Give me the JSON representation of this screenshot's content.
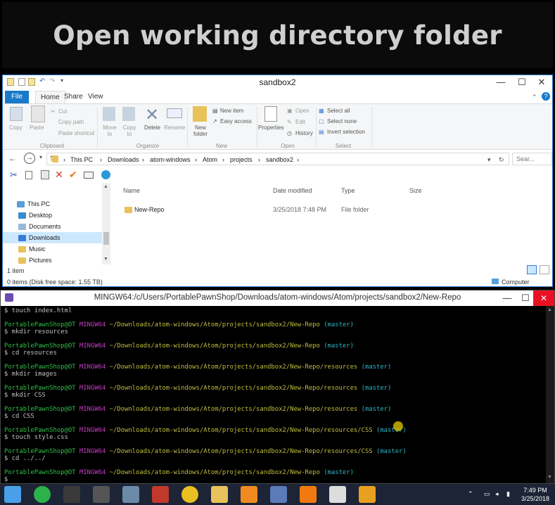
{
  "banner": {
    "title": "Open working directory folder"
  },
  "explorer": {
    "window_title": "sandbox2",
    "tabs": [
      "File",
      "Home",
      "Share",
      "View"
    ],
    "ribbon": {
      "clipboard": {
        "copy": "Copy",
        "paste": "Paste",
        "cut": "Cut",
        "copy_path": "Copy path",
        "paste_shortcut": "Paste shortcut",
        "group": "Clipboard"
      },
      "organize": {
        "move_to": "Move to",
        "copy_to": "Copy to",
        "delete": "Delete",
        "rename": "Rename",
        "group": "Organize"
      },
      "new": {
        "new_folder": "New folder",
        "new_item": "New item",
        "easy_access": "Easy access",
        "group": "New"
      },
      "open": {
        "properties": "Properties",
        "open": "Open",
        "edit": "Edit",
        "history": "History",
        "group": "Open"
      },
      "select": {
        "select_all": "Select all",
        "select_none": "Select none",
        "invert": "Invert selection",
        "group": "Select"
      }
    },
    "breadcrumb": [
      "This PC",
      "Downloads",
      "atom-windows",
      "Atom",
      "projects",
      "sandbox2"
    ],
    "search_placeholder": "Sear...",
    "nav": [
      "This PC",
      "Desktop",
      "Documents",
      "Downloads",
      "Music",
      "Pictures"
    ],
    "columns": {
      "name": "Name",
      "date": "Date modified",
      "type": "Type",
      "size": "Size"
    },
    "files": [
      {
        "name": "New-Repo",
        "date": "3/25/2018 7:48 PM",
        "type": "File folder"
      }
    ],
    "status": {
      "items": "1 item",
      "details": "0 items (Disk free space: 1.55 TB)",
      "computer": "Computer"
    }
  },
  "terminal": {
    "title": "MINGW64:/c/Users/PortablePawnShop/Downloads/atom-windows/Atom/projects/sandbox2/New-Repo",
    "user": "PortablePawnShop@OT",
    "host": "MINGW64",
    "first_cmd": "$ touch index.html",
    "blocks": [
      {
        "path": "~/Downloads/atom-windows/Atom/projects/sandbox2/New-Repo",
        "branch": "(master)",
        "cmd": "$ mkdir resources"
      },
      {
        "path": "~/Downloads/atom-windows/Atom/projects/sandbox2/New-Repo",
        "branch": "(master)",
        "cmd": "$ cd resources"
      },
      {
        "path": "~/Downloads/atom-windows/Atom/projects/sandbox2/New-Repo/resources",
        "branch": "(master)",
        "cmd": "$ mkdir images"
      },
      {
        "path": "~/Downloads/atom-windows/Atom/projects/sandbox2/New-Repo/resources",
        "branch": "(master)",
        "cmd": "$ mkdir CSS"
      },
      {
        "path": "~/Downloads/atom-windows/Atom/projects/sandbox2/New-Repo/resources",
        "branch": "(master)",
        "cmd": "$ cd CSS"
      },
      {
        "path": "~/Downloads/atom-windows/Atom/projects/sandbox2/New-Repo/resources/CSS",
        "branch": "(master)",
        "cmd": "$ touch style.css"
      },
      {
        "path": "~/Downloads/atom-windows/Atom/projects/sandbox2/New-Repo/resources/CSS",
        "branch": "(master)",
        "cmd": "$ cd ../../"
      },
      {
        "path": "~/Downloads/atom-windows/Atom/projects/sandbox2/New-Repo",
        "branch": "(master)",
        "cmd": "$ "
      }
    ]
  },
  "taskbar": {
    "time": "7:49 PM",
    "date": "3/25/2018"
  }
}
